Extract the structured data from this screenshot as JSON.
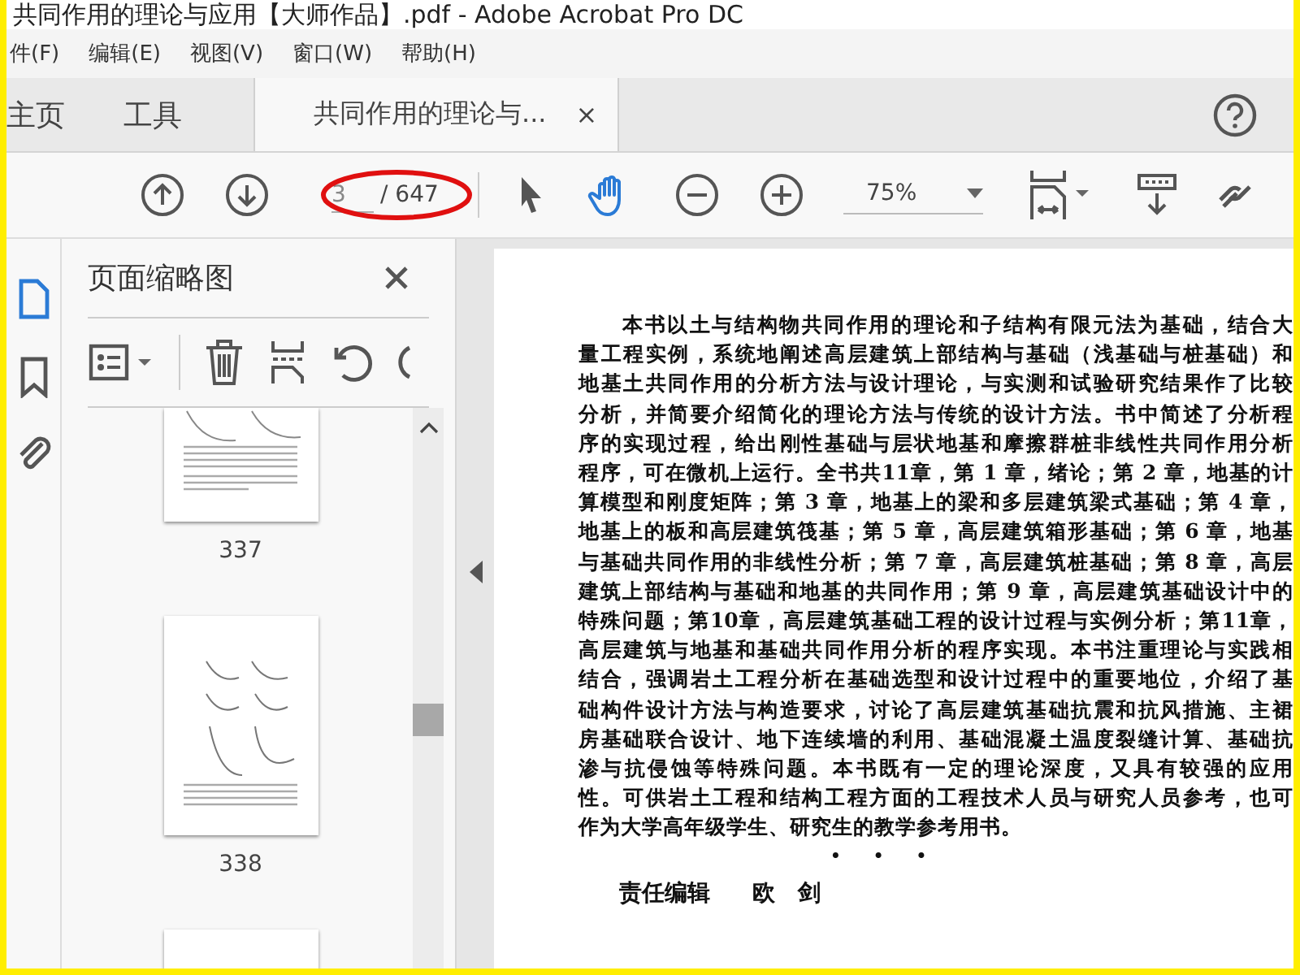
{
  "window": {
    "title": "共同作用的理论与应用【大师作品】.pdf - Adobe Acrobat Pro DC"
  },
  "menu": [
    "件(F)",
    "编辑(E)",
    "视图(V)",
    "窗口(W)",
    "帮助(H)"
  ],
  "tabs": [
    {
      "label": "主页",
      "kind": "plain",
      "selected": false
    },
    {
      "label": "工具",
      "kind": "plain",
      "selected": false
    },
    {
      "label": "共同作用的理论与...",
      "kind": "document",
      "selected": true,
      "close": "×"
    }
  ],
  "toolbar": {
    "page_value": "3",
    "page_total": "/ 647",
    "zoom": "75%"
  },
  "sidebar": {
    "tools": [
      {
        "kind": "pages",
        "selected": true
      },
      {
        "kind": "bookmark",
        "selected": false
      },
      {
        "kind": "attachment",
        "selected": false
      }
    ],
    "panel_title": "页面缩略图",
    "thumbnails": [
      "337",
      "338"
    ]
  },
  "document": {
    "lines": [
      "本书以土与结构物共同作用的理论和子结构有限元法为基础，结合大",
      "量工程实例，系统地阐述高层建筑上部结构与基础（浅基础与桩基础）和",
      "地基土共同作用的分析方法与设计理论，与实测和试验研究结果作了比较",
      "分析，并简要介绍简化的理论方法与传统的设计方法。书中简述了分析程",
      "序的实现过程，给出刚性基础与层状地基和摩擦群桩非线性共同作用分析",
      "程序，可在微机上运行。全书共11章，第 1 章，绪论；第 2 章，地基的计",
      "算模型和刚度矩阵；第 3 章，地基上的梁和多层建筑梁式基础；第 4 章，",
      "地基上的板和高层建筑筏基；第 5 章，高层建筑箱形基础；第 6 章，地基",
      "与基础共同作用的非线性分析；第 7 章，高层建筑桩基础；第 8 章，高层",
      "建筑上部结构与基础和地基的共同作用；第 9 章，高层建筑基础设计中的",
      "特殊问题；第10章，高层建筑基础工程的设计过程与实例分析；第11章，",
      "高层建筑与地基和基础共同作用分析的程序实现。本书注重理论与实践相",
      "结合，强调岩土工程分析在基础选型和设计过程中的重要地位，介绍了基",
      "础构件设计方法与构造要求，讨论了高层建筑基础抗震和抗风措施、主裙",
      "房基础联合设计、地下连续墙的利用、基础混凝土温度裂缝计算、基础抗",
      "渗与抗侵蚀等特殊问题。本书既有一定的理论深度，又具有较强的应用",
      "性。可供岩土工程和结构工程方面的工程技术人员与研究人员参考，也可",
      "作为大学高年级学生、研究生的教学参考用书。"
    ],
    "separator": "•　　•　　•",
    "editor_label": "责任编辑",
    "editor_name": "欧　剑"
  }
}
